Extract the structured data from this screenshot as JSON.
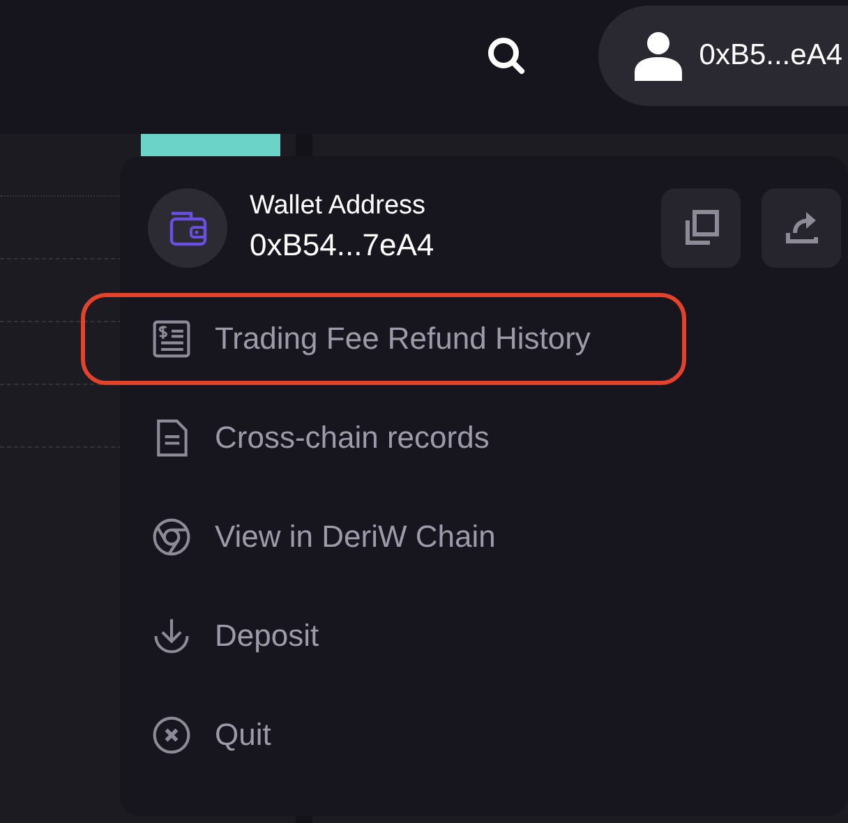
{
  "header": {
    "account": {
      "address": "0xB5...eA4"
    }
  },
  "wallet_menu": {
    "label": "Wallet Address",
    "address": "0xB54...7eA4",
    "items": [
      {
        "kind": "receipt",
        "label": "Trading Fee Refund History",
        "highlighted": true
      },
      {
        "kind": "document",
        "label": "Cross-chain records",
        "highlighted": false
      },
      {
        "kind": "explorer",
        "label": "View in DeriW Chain",
        "highlighted": false
      },
      {
        "kind": "deposit",
        "label": "Deposit",
        "highlighted": false
      },
      {
        "kind": "quit",
        "label": "Quit",
        "highlighted": false
      }
    ]
  }
}
